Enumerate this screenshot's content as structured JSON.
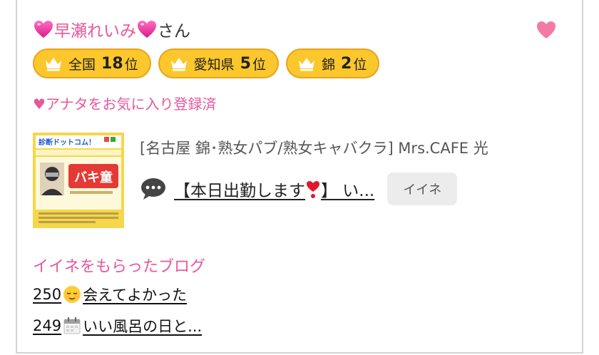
{
  "profile": {
    "name": "早瀬れいみ",
    "suffix": "さん",
    "heart_color": "#e8579a",
    "favorite_icon": "heart-icon"
  },
  "rank_badges": [
    {
      "label": "全国",
      "rank": "18",
      "unit": "位"
    },
    {
      "label": "愛知県",
      "rank": "5",
      "unit": "位"
    },
    {
      "label": "錦",
      "rank": "2",
      "unit": "位"
    }
  ],
  "favorite_status": "♥アナタをお気に入り登録済",
  "post": {
    "shop": "[名古屋 錦･熟女パブ/熟女キャバクラ]  Mrs.CAFE 光",
    "title_prefix": "【本日出勤します",
    "title_suffix": "】 い...",
    "like_button": "イイネ",
    "thumbnail": {
      "site": "診断ドットコム！",
      "badge": "バキ童"
    }
  },
  "liked_blogs": {
    "heading": "イイネをもらったブログ",
    "items": [
      {
        "count": "250",
        "emoji": "relieved-face",
        "title": "会えてよかった"
      },
      {
        "count": "249",
        "emoji": "calendar",
        "title": "いい風呂の日と..."
      }
    ]
  },
  "colors": {
    "accent_pink": "#e8579a",
    "badge_gold": "#fcc72c",
    "badge_border": "#e7a51a"
  }
}
